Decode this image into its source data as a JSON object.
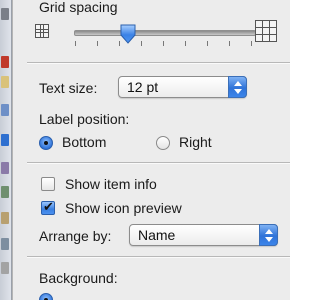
{
  "grid_spacing": {
    "title": "Grid spacing",
    "level": 0.3
  },
  "text_size": {
    "label": "Text size:",
    "value": "12 pt"
  },
  "label_position": {
    "label": "Label position:",
    "options": [
      "Bottom",
      "Right"
    ],
    "selected": "Bottom"
  },
  "options": {
    "show_item_info": {
      "label": "Show item info",
      "checked": false
    },
    "show_icon_preview": {
      "label": "Show icon preview",
      "checked": true
    }
  },
  "arrange_by": {
    "label": "Arrange by:",
    "value": "Name"
  },
  "background": {
    "label": "Background:"
  },
  "colors": {
    "accent": "#2f73d8",
    "panel": "#ececec"
  }
}
